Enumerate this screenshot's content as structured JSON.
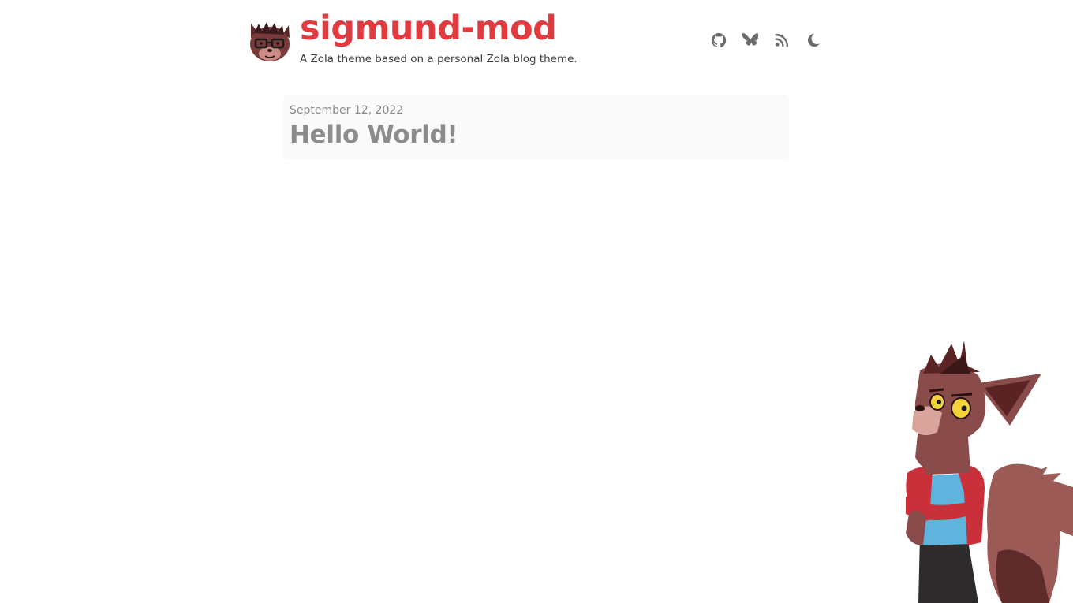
{
  "site": {
    "title": "sigmund-mod",
    "description": "A Zola theme based on a personal Zola blog theme.",
    "accent_color": "#e13a3f"
  },
  "nav": {
    "icons": [
      {
        "name": "github-icon"
      },
      {
        "name": "bluesky-icon"
      },
      {
        "name": "rss-icon"
      },
      {
        "name": "dark-mode-toggle-icon"
      }
    ],
    "icon_color": "#6b6b6b"
  },
  "posts": [
    {
      "date": "September 12, 2022",
      "title": "Hello World!"
    }
  ]
}
